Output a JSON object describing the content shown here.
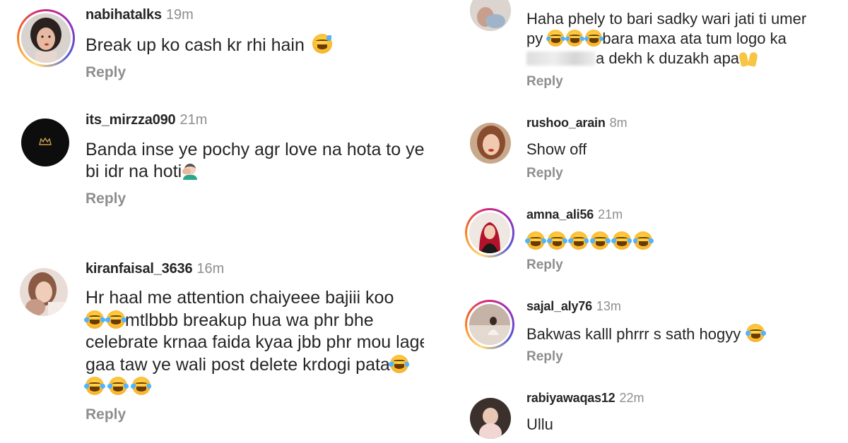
{
  "left": {
    "comments": [
      {
        "username": "nabihatalks",
        "time": "19m",
        "text": "Break up ko cash kr rhi hain",
        "reply": "Reply"
      },
      {
        "username": "its_mirzza090",
        "time": "21m",
        "text_line1": "Banda inse ye pochy agr love na hota to ye",
        "text_line2": "bi idr na hoti",
        "reply": "Reply"
      },
      {
        "username": "kiranfaisal_3636",
        "time": "16m",
        "text_line1": "Hr haal me attention chaiyeee bajiii koo",
        "text_line2": "mtlbbb breakup hua wa phr bhe",
        "text_line3": "celebrate krnaa faida kyaa jbb phr mou lage",
        "text_line4": "gaa taw ye wali post delete krdogi pata",
        "reply": "Reply"
      }
    ]
  },
  "right": {
    "comments": [
      {
        "username": "",
        "time": "",
        "text_line1": "Haha phely to bari sadky wari jati ti umer",
        "text_line2_a": "py",
        "text_line2_b": "bara maxa ata tum logo ka",
        "text_line3": "a dekh k duzakh apa",
        "reply": "Reply"
      },
      {
        "username": "rushoo_arain",
        "time": "8m",
        "text": "Show off",
        "reply": "Reply"
      },
      {
        "username": "amna_ali56",
        "time": "21m",
        "reply": "Reply"
      },
      {
        "username": "sajal_aly76",
        "time": "13m",
        "text": "Bakwas kalll phrrr s sath hogyy",
        "reply": "Reply"
      },
      {
        "username": "rabiyawaqas12",
        "time": "22m",
        "text": "Ullu"
      }
    ]
  },
  "colors": {
    "text": "#262626",
    "muted": "#8e8e8e",
    "emoji_yellow": "#ffd84a",
    "tear_blue": "#4fb3ff"
  },
  "icons": [
    "laughing-tears-emoji",
    "sweat-smile-emoji",
    "facepalm-emoji",
    "raised-hands-emoji",
    "crown-logo"
  ]
}
